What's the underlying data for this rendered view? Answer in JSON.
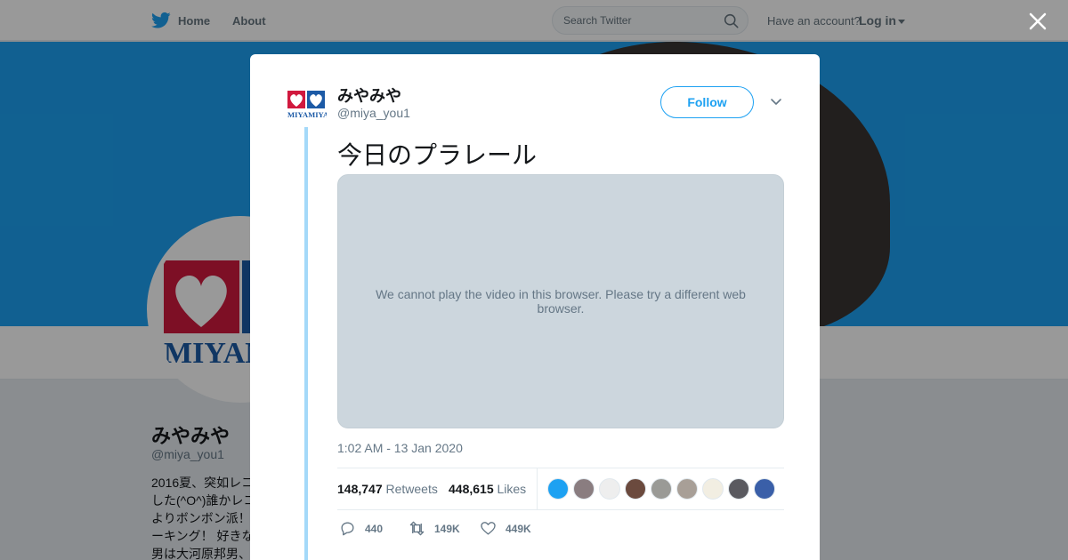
{
  "topbar": {
    "home_label": "Home",
    "about_label": "About",
    "search_placeholder": "Search Twitter",
    "have_account": "Have an account?",
    "login_label": "Log in"
  },
  "profile": {
    "name": "みやみや",
    "handle": "@miya_you1",
    "bio": "2016夏、突如レコ\nした(^O^)誰かレコ\nよりボンボン派！\nーキング！ 好きな\n男は大河原邦男、",
    "logo_text": "MIYAMIYA"
  },
  "modal": {
    "name": "みやみや",
    "handle": "@miya_you1",
    "follow_label": "Follow",
    "tweet_text": "今日のプラレール",
    "media_message": "We cannot play the video in this browser. Please try a different web browser.",
    "timestamp": "1:02 AM - 13 Jan 2020",
    "retweets_count": "148,747",
    "retweets_label": "Retweets",
    "likes_count": "448,615",
    "likes_label": "Likes",
    "likers": [
      {
        "color": "#1da1f2"
      },
      {
        "color": "#8a7d80"
      },
      {
        "color": "#eeeeee"
      },
      {
        "color": "#6b4a3e"
      },
      {
        "color": "#9a9a96"
      },
      {
        "color": "#a89f97"
      },
      {
        "color": "#f2eee2"
      },
      {
        "color": "#5a5a60"
      },
      {
        "color": "#3a5fa8"
      }
    ],
    "actions": {
      "reply_count": "440",
      "retweet_count": "149K",
      "like_count": "449K"
    }
  },
  "colors": {
    "brand": "#1da1f2",
    "thread_line": "#a4d9f9",
    "muted": "#657786",
    "logo_red": "#d1193e",
    "logo_blue": "#1c5aa6"
  },
  "icons": [
    "twitter-bird-icon",
    "search-icon",
    "close-icon",
    "chevron-down-icon",
    "reply-icon",
    "retweet-icon",
    "heart-icon"
  ]
}
